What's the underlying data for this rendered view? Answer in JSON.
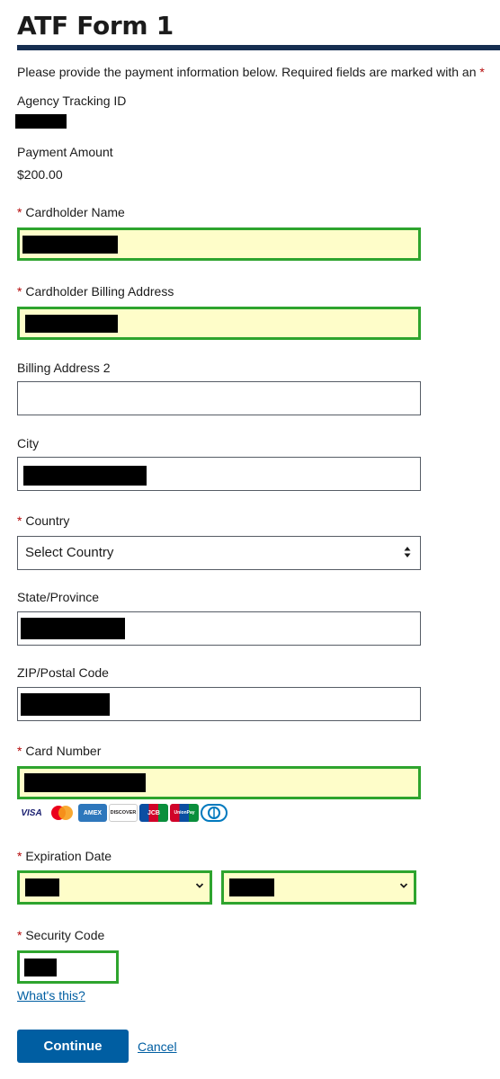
{
  "page": {
    "title": "ATF Form 1"
  },
  "intro": {
    "text": "Please provide the payment information below. Required fields are marked with an",
    "marker": "*"
  },
  "tracking": {
    "label": "Agency Tracking ID"
  },
  "amount": {
    "label": "Payment Amount",
    "value": "$200.00"
  },
  "fields": {
    "cardholder_name": {
      "label": "Cardholder Name",
      "required": "*"
    },
    "billing_address": {
      "label": "Cardholder Billing Address",
      "required": "*"
    },
    "billing_address_2": {
      "label": "Billing Address 2"
    },
    "city": {
      "label": "City"
    },
    "country": {
      "label": "Country",
      "required": "*",
      "value": "Select Country"
    },
    "state": {
      "label": "State/Province"
    },
    "zip": {
      "label": "ZIP/Postal Code"
    },
    "card_number": {
      "label": "Card Number",
      "required": "*"
    },
    "expiration": {
      "label": "Expiration Date",
      "required": "*"
    },
    "security_code": {
      "label": "Security Code",
      "required": "*"
    }
  },
  "card_brands": [
    {
      "name": "VISA",
      "color": "#1a1f71"
    },
    {
      "name": "MasterCard",
      "color": "#eb001b"
    },
    {
      "name": "AMEX",
      "color": "#2e77bc"
    },
    {
      "name": "DISCOVER",
      "color": "#f58220"
    },
    {
      "name": "JCB",
      "color": "#0b4ea2"
    },
    {
      "name": "UnionPay",
      "color": "#d10429"
    },
    {
      "name": "Diners",
      "color": "#0079be"
    }
  ],
  "links": {
    "whats_this": "What's this?",
    "cancel": "Cancel"
  },
  "buttons": {
    "continue": "Continue"
  },
  "colors": {
    "accent": "#005ea2",
    "title_rule": "#162e51",
    "highlight_border": "#2ea42e",
    "highlight_bg": "#fefdc9",
    "required": "#b50909"
  }
}
